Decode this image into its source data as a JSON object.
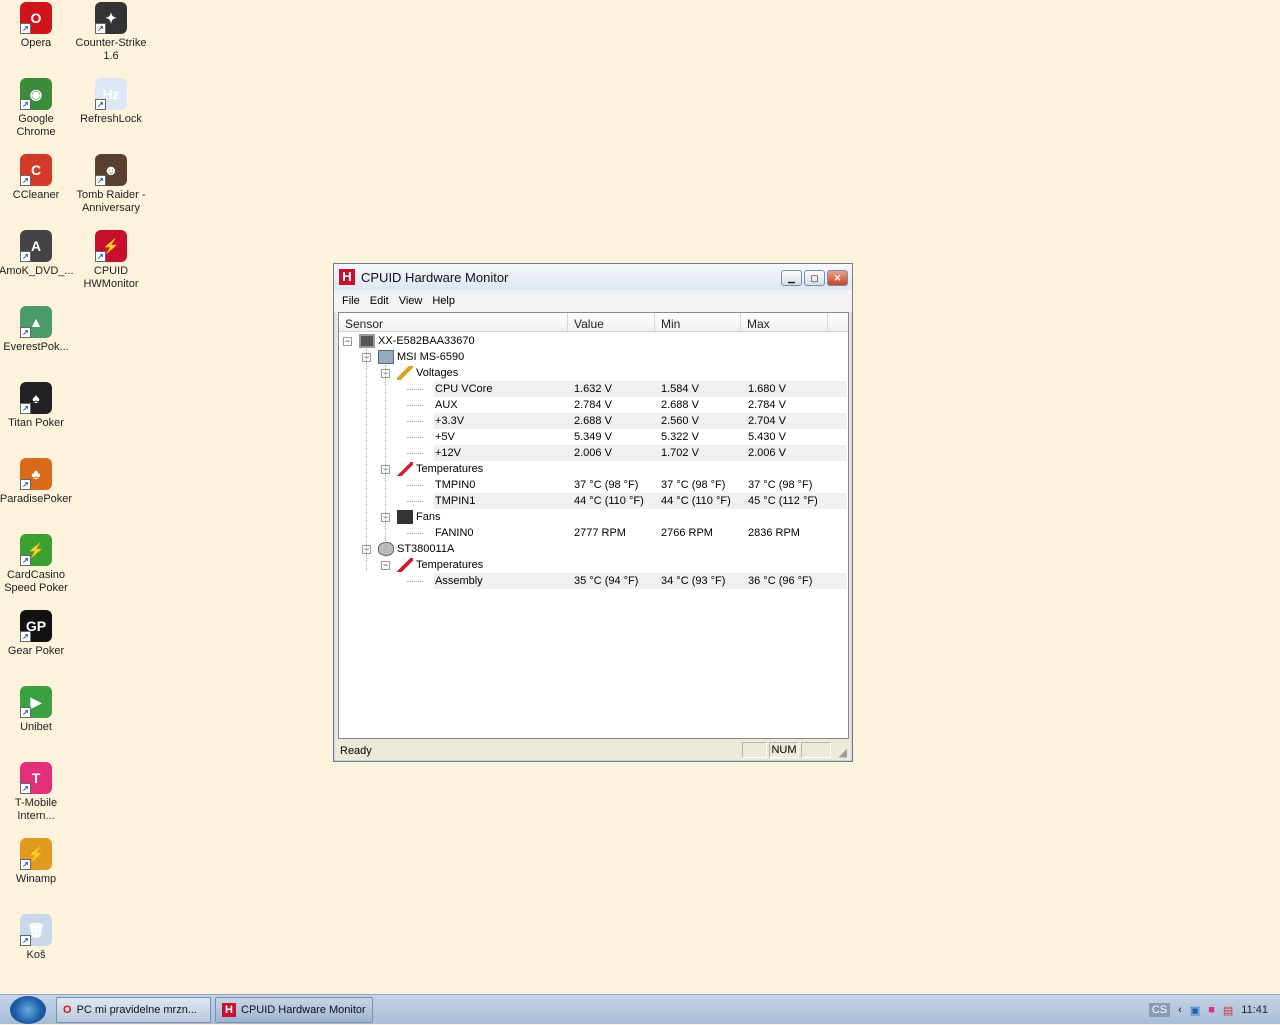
{
  "desktop_icons": [
    {
      "label": "Opera",
      "color": "#d0141b",
      "glyph": "O"
    },
    {
      "label": "Counter-Strike 1.6",
      "color": "#333333",
      "glyph": "✦"
    },
    {
      "label": "Google Chrome",
      "color": "#3a8c3a",
      "glyph": "◉"
    },
    {
      "label": "RefreshLock",
      "color": "#dde6f5",
      "glyph": "Hz"
    },
    {
      "label": "CCleaner",
      "color": "#d33a2a",
      "glyph": "C"
    },
    {
      "label": "Tomb Raider - Anniversary",
      "color": "#5a4030",
      "glyph": "☻"
    },
    {
      "label": "AmoK_DVD_...",
      "color": "#444444",
      "glyph": "A"
    },
    {
      "label": "CPUID HWMonitor",
      "color": "#c8102e",
      "glyph": "⚡"
    },
    {
      "label": "EverestPok...",
      "color": "#4a9a6a",
      "glyph": "▲"
    },
    {
      "label": "Titan Poker",
      "color": "#222222",
      "glyph": "♠"
    },
    {
      "label": "ParadisePoker",
      "color": "#d86a1a",
      "glyph": "♣"
    },
    {
      "label": "CardCasino Speed Poker",
      "color": "#3aa030",
      "glyph": "⚡"
    },
    {
      "label": "Gear Poker",
      "color": "#111111",
      "glyph": "GP"
    },
    {
      "label": "Unibet",
      "color": "#3aa040",
      "glyph": "▶"
    },
    {
      "label": "T-Mobile Intern...",
      "color": "#e0307a",
      "glyph": "T"
    },
    {
      "label": "Winamp",
      "color": "#e09a20",
      "glyph": "⚡"
    },
    {
      "label": "Koš",
      "color": "#c8d8ea",
      "glyph": "🗑"
    }
  ],
  "window": {
    "title": "CPUID Hardware Monitor",
    "menu": [
      "File",
      "Edit",
      "View",
      "Help"
    ],
    "columns": [
      "Sensor",
      "Value",
      "Min",
      "Max"
    ],
    "rows": [
      {
        "level": 0,
        "type": "node",
        "icon": "computer-icon",
        "label": "XX-E582BAA33670"
      },
      {
        "level": 1,
        "type": "node",
        "icon": "motherboard-icon",
        "label": "MSI MS-6590"
      },
      {
        "level": 2,
        "type": "node",
        "icon": "voltage-icon",
        "label": "Voltages"
      },
      {
        "level": 3,
        "type": "leaf",
        "label": "CPU VCore",
        "value": "1.632 V",
        "min": "1.584 V",
        "max": "1.680 V"
      },
      {
        "level": 3,
        "type": "leaf",
        "label": "AUX",
        "value": "2.784 V",
        "min": "2.688 V",
        "max": "2.784 V"
      },
      {
        "level": 3,
        "type": "leaf",
        "label": "+3.3V",
        "value": "2.688 V",
        "min": "2.560 V",
        "max": "2.704 V"
      },
      {
        "level": 3,
        "type": "leaf",
        "label": "+5V",
        "value": "5.349 V",
        "min": "5.322 V",
        "max": "5.430 V"
      },
      {
        "level": 3,
        "type": "leaf",
        "label": "+12V",
        "value": "2.006 V",
        "min": "1.702 V",
        "max": "2.006 V"
      },
      {
        "level": 2,
        "type": "node",
        "icon": "thermometer-icon",
        "label": "Temperatures"
      },
      {
        "level": 3,
        "type": "leaf",
        "label": "TMPIN0",
        "value": "37 °C  (98 °F)",
        "min": "37 °C  (98 °F)",
        "max": "37 °C  (98 °F)"
      },
      {
        "level": 3,
        "type": "leaf",
        "label": "TMPIN1",
        "value": "44 °C  (110 °F)",
        "min": "44 °C  (110 °F)",
        "max": "45 °C  (112 °F)"
      },
      {
        "level": 2,
        "type": "node",
        "icon": "fan-icon",
        "label": "Fans"
      },
      {
        "level": 3,
        "type": "leaf",
        "label": "FANIN0",
        "value": "2777 RPM",
        "min": "2766 RPM",
        "max": "2836 RPM"
      },
      {
        "level": 1,
        "type": "node",
        "icon": "hard-disk-icon",
        "label": "ST380011A"
      },
      {
        "level": 2,
        "type": "node",
        "icon": "thermometer-icon",
        "label": "Temperatures"
      },
      {
        "level": 3,
        "type": "leaf",
        "label": "Assembly",
        "value": "35 °C  (94 °F)",
        "min": "34 °C  (93 °F)",
        "max": "36 °C  (96 °F)"
      }
    ],
    "status": "Ready",
    "status_num": "NUM"
  },
  "taskbar": {
    "tasks": [
      "PC mi pravidelne mrzn...",
      "CPUID Hardware Monitor"
    ],
    "language": "CS",
    "clock": "11:41"
  }
}
